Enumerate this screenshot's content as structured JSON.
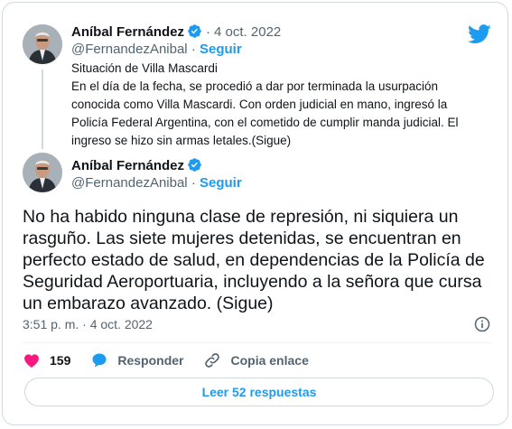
{
  "tweet": {
    "quoted": {
      "author_name": "Aníbal Fernández",
      "dot": "·",
      "date": "4 oct. 2022",
      "handle": "@FernandezAnibal",
      "follow_label": "Seguir",
      "text": "Situación de Villa Mascardi\nEn el día de la fecha, se procedió a dar por terminada la usurpación conocida como Villa Mascardi. Con orden judicial en mano, ingresó la Policía Federal Argentina, con el cometido de cumplir manda judicial. El ingreso se hizo sin armas letales.(Sigue)"
    },
    "main": {
      "author_name": "Aníbal Fernández",
      "handle": "@FernandezAnibal",
      "dot": "·",
      "follow_label": "Seguir",
      "text": "No ha habido ninguna clase de represión, ni siquiera un rasguño. Las siete mujeres detenidas, se encuentran en perfecto estado de salud, en dependencias de la Policía de Seguridad Aeroportuaria, incluyendo a la señora que cursa un embarazo avanzado. (Sigue)",
      "timestamp": "3:51 p. m. · 4 oct. 2022"
    },
    "actions": {
      "like_count": "159",
      "reply_label": "Responder",
      "copy_link_label": "Copia enlace"
    },
    "read_replies_label": "Leer 52 respuestas"
  },
  "colors": {
    "brand_blue": "#1d9bf0",
    "like_red": "#f91880",
    "secondary_text": "#536471"
  },
  "icons": [
    "twitter-bird-icon",
    "verified-badge-icon",
    "info-icon",
    "heart-icon",
    "reply-bubble-icon",
    "link-icon"
  ]
}
